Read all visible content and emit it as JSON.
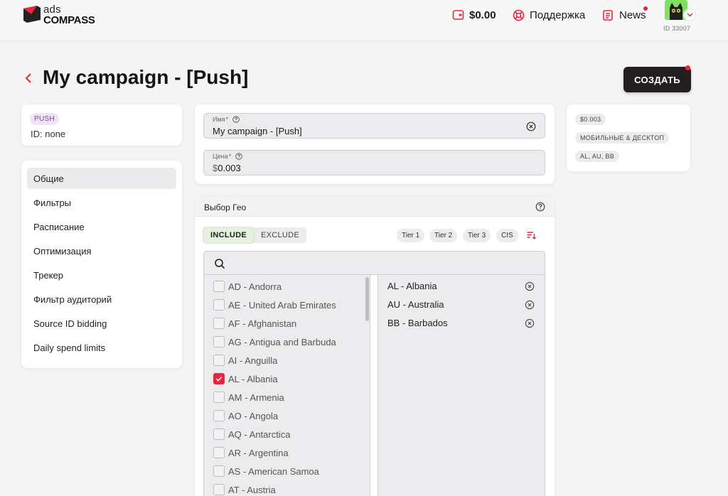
{
  "header": {
    "logo_line1": "ads",
    "logo_line2": "COMPASS",
    "balance": "$0.00",
    "support": "Поддержка",
    "news": "News",
    "user_id": "ID 33007"
  },
  "page": {
    "title": "My campaign - [Push]",
    "create_label": "СОЗДАТЬ"
  },
  "id_card": {
    "type_badge": "PUSH",
    "id_line": "ID: none"
  },
  "sidebar": {
    "items": [
      {
        "label": "Общие",
        "active": true
      },
      {
        "label": "Фильтры",
        "active": false
      },
      {
        "label": "Расписание",
        "active": false
      },
      {
        "label": "Оптимизация",
        "active": false
      },
      {
        "label": "Трекер",
        "active": false
      },
      {
        "label": "Фильтр аудиторий",
        "active": false
      },
      {
        "label": "Source ID bidding",
        "active": false
      },
      {
        "label": "Daily spend limits",
        "active": false
      }
    ]
  },
  "fields": {
    "name": {
      "label": "Имя",
      "value": "My campaign - [Push]"
    },
    "price": {
      "label": "Цена",
      "currency": "$",
      "value": "0.003"
    }
  },
  "summary": {
    "price": "$0.003",
    "devices": "МОБИЛЬНЫЕ & ДЕСКТОП",
    "geo": "AL, AU, BB"
  },
  "geo": {
    "title": "Выбор Гео",
    "include": "INCLUDE",
    "exclude": "EXCLUDE",
    "tiers": [
      "Tier 1",
      "Tier 2",
      "Tier 3",
      "CIS"
    ],
    "search_placeholder": "",
    "countries": [
      {
        "label": "AD - Andorra",
        "checked": false
      },
      {
        "label": "AE - United Arab Emirates",
        "checked": false
      },
      {
        "label": "AF - Afghanistan",
        "checked": false
      },
      {
        "label": "AG - Antigua and Barbuda",
        "checked": false
      },
      {
        "label": "AI - Anguilla",
        "checked": false
      },
      {
        "label": "AL - Albania",
        "checked": true
      },
      {
        "label": "AM - Armenia",
        "checked": false
      },
      {
        "label": "AO - Angola",
        "checked": false
      },
      {
        "label": "AQ - Antarctica",
        "checked": false
      },
      {
        "label": "AR - Argentina",
        "checked": false
      },
      {
        "label": "AS - American Samoa",
        "checked": false
      },
      {
        "label": "AT - Austria",
        "checked": false
      }
    ],
    "selected": [
      "AL - Albania",
      "AU - Australia",
      "BB - Barbados"
    ]
  },
  "colors": {
    "accent": "#e8253f",
    "dark_button": "#231f20",
    "include_active": "#e3f1dd"
  }
}
